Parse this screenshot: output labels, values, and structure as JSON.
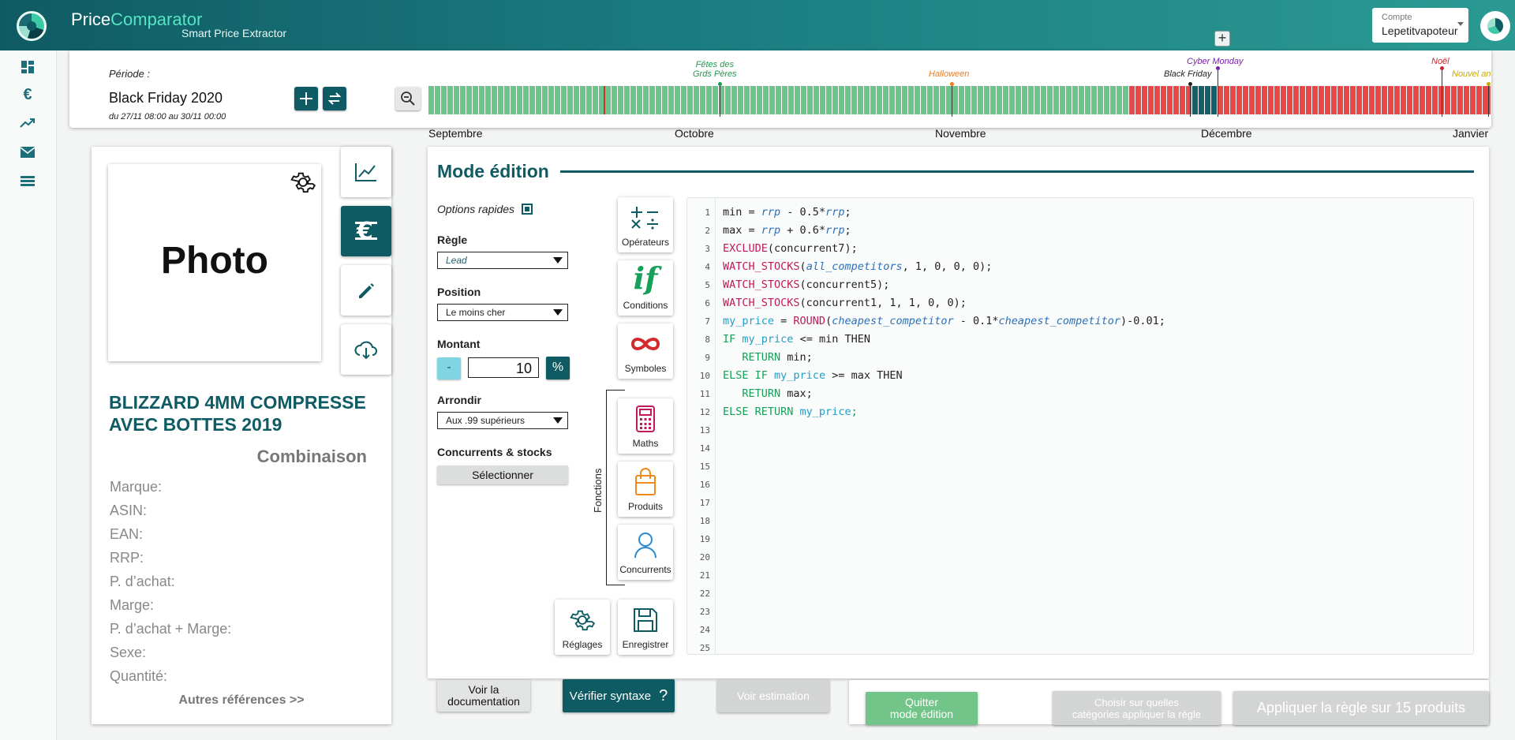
{
  "header": {
    "brand_part1": "Price",
    "brand_part2": "Comparator",
    "subtitle": "Smart Price Extractor",
    "account_label": "Compte",
    "account_value": "Lepetitvapoteur"
  },
  "nav": {
    "items": [
      {
        "name": "dashboard-icon",
        "glyph": "▦"
      },
      {
        "name": "euro-icon",
        "glyph": "€"
      },
      {
        "name": "trending-icon",
        "glyph": "↗"
      },
      {
        "name": "mail-icon",
        "glyph": "✉"
      },
      {
        "name": "list-icon",
        "glyph": "☰"
      }
    ]
  },
  "period": {
    "label": "Période :",
    "name": "Black Friday 2020",
    "range": "du 27/11 08:00 au 30/11 00:00",
    "months": [
      "Septembre",
      "Octobre",
      "Novembre",
      "Décembre",
      "Janvier"
    ],
    "events": [
      {
        "line1": "Fêtes des",
        "line2": "Grds Pères",
        "color": "#1e9a4e"
      },
      {
        "line1": "Halloween",
        "line2": "",
        "color": "#f07a1a"
      },
      {
        "line1": "Black Friday",
        "line2": "",
        "color": "#222222"
      },
      {
        "line1": "Cyber Monday",
        "line2": "",
        "color": "#7a1fa8"
      },
      {
        "line1": "Noël",
        "line2": "",
        "color": "#d01f2a"
      },
      {
        "line1": "Nouvel an",
        "line2": "",
        "color": "#c9a800"
      }
    ],
    "colors": {
      "green": "#6cc48a",
      "red": "#e84848",
      "selected": "#145e6a"
    }
  },
  "product": {
    "photo_label": "Photo",
    "title": "BLIZZARD 4MM COMPRESSE AVEC BOTTES 2019",
    "category": "Combinaison",
    "fields": [
      "Marque:",
      "ASIN:",
      "EAN:",
      "RRP:",
      "P. d’achat:",
      "Marge:",
      "P. d’achat + Marge:",
      "Sexe:",
      "Quantité:"
    ],
    "more_link": "Autres références >>"
  },
  "editor": {
    "title": "Mode édition",
    "quick_options": "Options rapides",
    "rule_label": "Règle",
    "rule_value": "Lead",
    "position_label": "Position",
    "position_value": "Le moins cher",
    "amount_label": "Montant",
    "amount_minus": "-",
    "amount_value": "10",
    "amount_unit": "%",
    "round_label": "Arrondir",
    "round_value": "Aux .99 supérieurs",
    "competitors_label": "Concurrents & stocks",
    "competitors_button": "Sélectionner",
    "tools": {
      "operators": "Opérateurs",
      "conditions": "Conditions",
      "symbols": "Symboles",
      "maths": "Maths",
      "products": "Produits",
      "competitors": "Concurrents",
      "settings": "Réglages",
      "save": "Enregistrer",
      "functions_group": "Fonctions"
    },
    "code_lines": [
      "min = rrp - 0.5*rrp;",
      "max = rrp + 0.6*rrp;",
      "EXCLUDE(concurrent7);",
      "WATCH_STOCKS(all_competitors, 1, 0, 0, 0);",
      "WATCH_STOCKS(concurrent5);",
      "WATCH_STOCKS(concurrent1, 1, 1, 0, 0);",
      "my_price = ROUND(cheapest_competitor - 0.1*cheapest_competitor)-0.01;",
      "IF my_price <= min THEN",
      "   RETURN min;",
      "ELSE IF my_price >= max THEN",
      "   RETURN max;",
      "ELSE RETURN my_price;",
      "",
      "",
      "",
      "",
      "",
      "",
      "",
      "",
      "",
      "",
      "",
      "",
      ""
    ],
    "line_numbers": [
      "1",
      "2",
      "3",
      "4",
      "5",
      "6",
      "7",
      "8",
      "9",
      "10",
      "11",
      "12",
      "13",
      "14",
      "15",
      "16",
      "17",
      "18",
      "19",
      "20",
      "21",
      "22",
      "23",
      "24",
      "25"
    ]
  },
  "footer": {
    "doc_button": "Voir la documentation",
    "doc_line1": "Voir la",
    "doc_line2": "documentation",
    "verify_button": "Vérifier syntaxe",
    "estimate_button": "Voir estimation",
    "quit_line1": "Quitter",
    "quit_line2": "mode édition",
    "choose_line1": "Choisir sur quelles",
    "choose_line2": "catégories appliquer la règle",
    "apply_button": "Appliquer la règle sur 15 produits"
  }
}
